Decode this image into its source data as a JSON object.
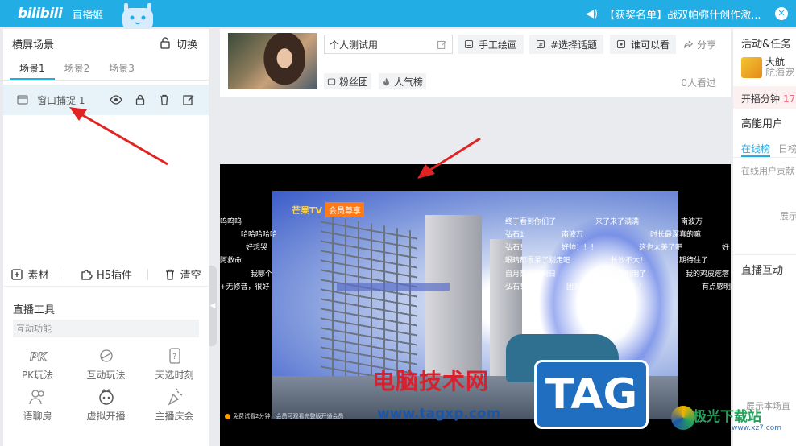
{
  "topbar": {
    "logo": "bilibili",
    "app_name": "直播姬",
    "notice": "【获奖名单】战双帕弥什创作激..."
  },
  "scenes": {
    "title": "横屏场景",
    "switch_label": "切换",
    "tabs": [
      "场景1",
      "场景2",
      "场景3"
    ],
    "source_name": "窗口捕捉 1",
    "buttons": {
      "material": "素材",
      "h5": "H5插件",
      "clear": "清空"
    }
  },
  "tools": {
    "title": "直播工具",
    "section": "互动功能",
    "items": [
      "PK玩法",
      "互动玩法",
      "天选时刻",
      "语聊房",
      "虚拟开播",
      "主播庆会"
    ]
  },
  "room": {
    "title": "个人测试用",
    "category": "手工绘画",
    "topic": "#选择话题",
    "visibility": "谁可以看",
    "share": "分享",
    "fans": "粉丝团",
    "popularity": "人气榜",
    "viewers": "0人看过"
  },
  "video": {
    "logo_text": "芒果TV",
    "logo_badge": "会员尊享",
    "tip": "免费试看2分钟，会员可观看完整版开通会员",
    "danmu": [
      "呜呜呜",
      "哈哈哈哈哈",
      "好想哭",
      "阿救命",
      "我哪个",
      "+无修音，很好",
      "终于看到你们了",
      "来了来了满满",
      "南波万",
      "弘石1",
      "南波万",
      "时长最深真的嘛",
      "弘石！",
      "好帅！！！",
      "这也太美了吧",
      "好",
      "眼睛都看呆了别走吧",
      "长沙不大！",
      "期待住了",
      "自月亮照的同日",
      "叹气，想明明了",
      "我的鸡皮疙瘩",
      "弘石！！",
      "团友多多，都在这误！！",
      "有点感明"
    ]
  },
  "right_panel": {
    "activities_title": "活动&任务",
    "activity_name": "大航",
    "activity_sub": "航海宠",
    "stream_time_label": "开播分钟",
    "stream_time_value": "17",
    "high_users_title": "高能用户",
    "tab_online": "在线榜",
    "tab_daily": "日榜",
    "online_contrib": "在线用户贡献",
    "show_label": "展示",
    "interaction_title": "直播互动",
    "bottom_text": "展示本场直"
  },
  "watermarks": {
    "cn": "电脑技术网",
    "url": "www.tagxp.com",
    "tag": "TAG",
    "xz": "极光下载站",
    "xz_url": "www.xz7.com"
  }
}
